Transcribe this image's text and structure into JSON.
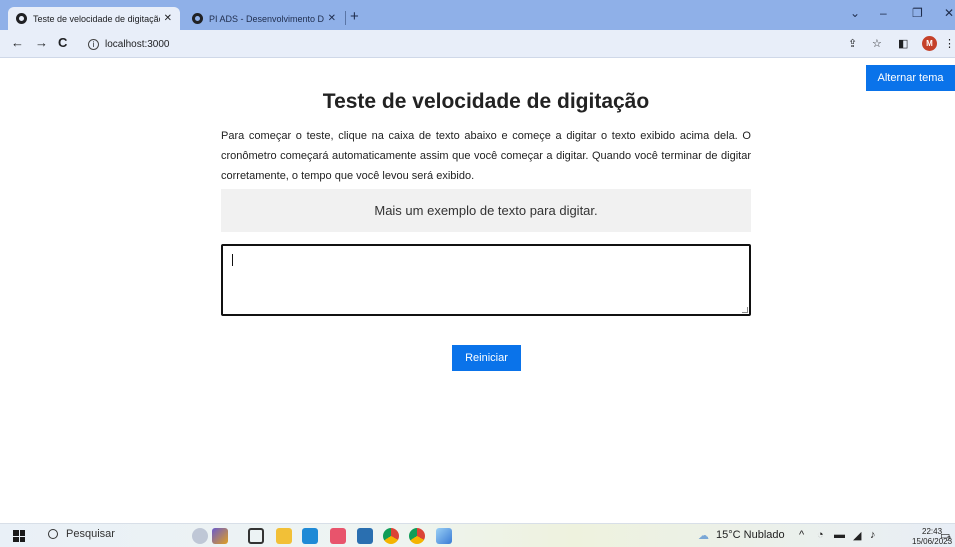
{
  "browser": {
    "tabs": [
      {
        "title": "Teste de velocidade de digitação",
        "close": "✕"
      },
      {
        "title": "PI ADS - Desenvolvimento Deskt",
        "close": "✕"
      }
    ],
    "new_tab": "+",
    "url": "localhost:3000",
    "info_glyph": "i",
    "profile_initial": "M"
  },
  "page": {
    "theme_button": "Alternar tema",
    "title": "Teste de velocidade de digitação",
    "intro": "Para começar o teste, clique na caixa de texto abaixo e começe a digitar o texto exibido acima dela. O cronômetro começará automaticamente assim que você começar a digitar. Quando você terminar de digitar corretamente, o tempo que você levou será exibido.",
    "sample_text": "Mais um exemplo de texto para digitar.",
    "input_value": "",
    "reset_button": "Reiniciar"
  },
  "taskbar": {
    "search_placeholder": "Pesquisar",
    "weather": "15°C  Nublado",
    "time": "22:43",
    "date": "15/06/2023",
    "notification_count": "2"
  },
  "colors": {
    "accent": "#0a73ea",
    "tabstrip": "#8fb0e8"
  }
}
